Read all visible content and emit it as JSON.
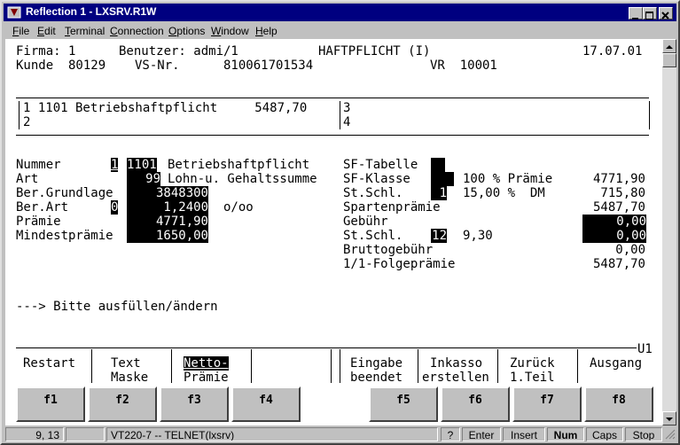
{
  "titlebar": {
    "title": "Reflection 1 - LXSRV.R1W"
  },
  "menu": [
    {
      "pre": "",
      "key": "F",
      "post": "ile"
    },
    {
      "pre": "",
      "key": "E",
      "post": "dit"
    },
    {
      "pre": "",
      "key": "T",
      "post": "erminal"
    },
    {
      "pre": "",
      "key": "C",
      "post": "onnection"
    },
    {
      "pre": "",
      "key": "O",
      "post": "ptions"
    },
    {
      "pre": "",
      "key": "W",
      "post": "indow"
    },
    {
      "pre": "",
      "key": "H",
      "post": "elp"
    }
  ],
  "header": {
    "firma": "Firma: 1",
    "benutzer": "Benutzer: admi/1",
    "module": "HAFTPFLICHT (I)",
    "date": "17.07.01",
    "kunde": "Kunde  80129",
    "vsnr_label": "VS-Nr.",
    "vsnr": "810061701534",
    "vr": "VR  10001"
  },
  "sparten": {
    "left1": "1 1101 Betriebshaftpflicht     5487,70",
    "left2": "2",
    "right1": "3",
    "right2": "4"
  },
  "form_left": {
    "nummer_label": "Nummer",
    "nummer_idx": "1",
    "nummer_code": "1101",
    "nummer_text": "Betriebshaftpflicht",
    "art_label": "Art",
    "art_code": "99",
    "art_text": "Lohn-u. Gehaltssumme",
    "bergrund_label": "Ber.Grundlage",
    "bergrund_value": "3848300",
    "berart_label": "Ber.Art",
    "berart_idx": "0",
    "berart_value": "1,2400",
    "berart_unit": "o/oo",
    "praemie_label": "Prämie",
    "praemie_value": "4771,90",
    "mindest_label": "Mindestprämie",
    "mindest_value": "1650,00"
  },
  "form_right": {
    "sftab_label": "SF-Tabelle",
    "sfkl_label": "SF-Klasse",
    "sfkl_text": "100 % Prämie",
    "sfkl_value": "4771,90",
    "stschl1_label": "St.Schl.",
    "stschl1_idx": "1",
    "stschl1_text": "15,00 %  DM",
    "stschl1_value": "715,80",
    "sparten_label": "Spartenprämie",
    "sparten_value": "5487,70",
    "gebuehr_label": "Gebühr",
    "gebuehr_value": "0,00",
    "stschl2_label": "St.Schl.",
    "stschl2_idx": "12",
    "stschl2_text": "9,30",
    "stschl2_value": "0,00",
    "brutto_label": "Bruttogebühr",
    "brutto_value": "0,00",
    "folge_label": "1/1-Folgeprämie",
    "folge_value": "5487,70"
  },
  "message": "---> Bitte ausfüllen/ändern",
  "screen_id": "U1",
  "softkeys": [
    {
      "l1": "Restart",
      "l2": ""
    },
    {
      "l1": "Text",
      "l2": "Maske"
    },
    {
      "l1": "Netto-",
      "l2": "Prämie"
    },
    {
      "l1": "",
      "l2": ""
    },
    {
      "l1": "Eingabe",
      "l2": "beendet"
    },
    {
      "l1": "Inkasso",
      "l2": "erstellen"
    },
    {
      "l1": "Zurück",
      "l2": "1.Teil"
    },
    {
      "l1": "Ausgang",
      "l2": ""
    }
  ],
  "fkeys": [
    "f1",
    "f2",
    "f3",
    "f4",
    "f5",
    "f6",
    "f7",
    "f8"
  ],
  "status": {
    "cursor": "9, 13",
    "session": "VT220-7 -- TELNET(lxsrv)",
    "help": "?",
    "enter": "Enter",
    "insert": "Insert",
    "num": "Num",
    "caps": "Caps",
    "stop": "Stop"
  },
  "colors": {
    "titlebar": "#000080",
    "terminal_bg": "#ffffff",
    "chrome": "#c0c0c0"
  }
}
